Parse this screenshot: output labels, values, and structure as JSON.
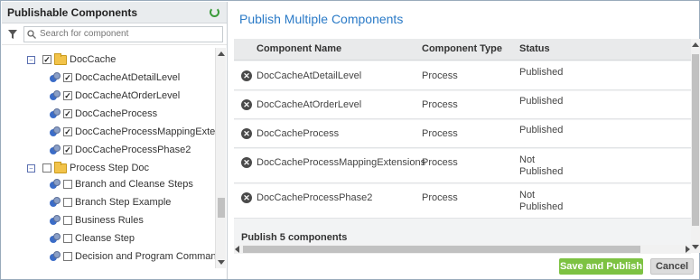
{
  "left_panel": {
    "title": "Publishable Components",
    "search_placeholder": "Search for component",
    "tree": [
      {
        "label": "DocCache",
        "checked": true,
        "type": "folder",
        "expander": "−"
      },
      {
        "label": "DocCacheAtDetailLevel",
        "checked": true,
        "type": "component"
      },
      {
        "label": "DocCacheAtOrderLevel",
        "checked": true,
        "type": "component"
      },
      {
        "label": "DocCacheProcess",
        "checked": true,
        "type": "component"
      },
      {
        "label": "DocCacheProcessMappingExtensions",
        "checked": true,
        "type": "component"
      },
      {
        "label": "DocCacheProcessPhase2",
        "checked": true,
        "type": "component"
      },
      {
        "label": "Process Step Doc",
        "checked": false,
        "type": "folder",
        "expander": "−"
      },
      {
        "label": "Branch and Cleanse Steps",
        "checked": false,
        "type": "component"
      },
      {
        "label": "Branch Step Example",
        "checked": false,
        "type": "component"
      },
      {
        "label": "Business Rules",
        "checked": false,
        "type": "component"
      },
      {
        "label": "Cleanse Step",
        "checked": false,
        "type": "component"
      },
      {
        "label": "Decision and Program Command",
        "checked": false,
        "type": "component"
      }
    ]
  },
  "right_panel": {
    "title": "Publish Multiple Components",
    "columns": [
      "Component Name",
      "Component Type",
      "Status"
    ],
    "rows": [
      {
        "name": "DocCacheAtDetailLevel",
        "type": "Process",
        "status_line1": "Published",
        "status_line2": ""
      },
      {
        "name": "DocCacheAtOrderLevel",
        "type": "Process",
        "status_line1": "Published",
        "status_line2": ""
      },
      {
        "name": "DocCacheProcess",
        "type": "Process",
        "status_line1": "Published",
        "status_line2": ""
      },
      {
        "name": "DocCacheProcessMappingExtensions",
        "type": "Process",
        "status_line1": "Not",
        "status_line2": "Published"
      },
      {
        "name": "DocCacheProcessPhase2",
        "type": "Process",
        "status_line1": "Not",
        "status_line2": "Published"
      }
    ],
    "summary": "Publish 5 components",
    "save_button": "Save and Publish",
    "cancel_button": "Cancel"
  },
  "colors": {
    "accent_title": "#2a7ac7",
    "save_button": "#7dc242",
    "refresh_icon": "#3a9b3a"
  }
}
